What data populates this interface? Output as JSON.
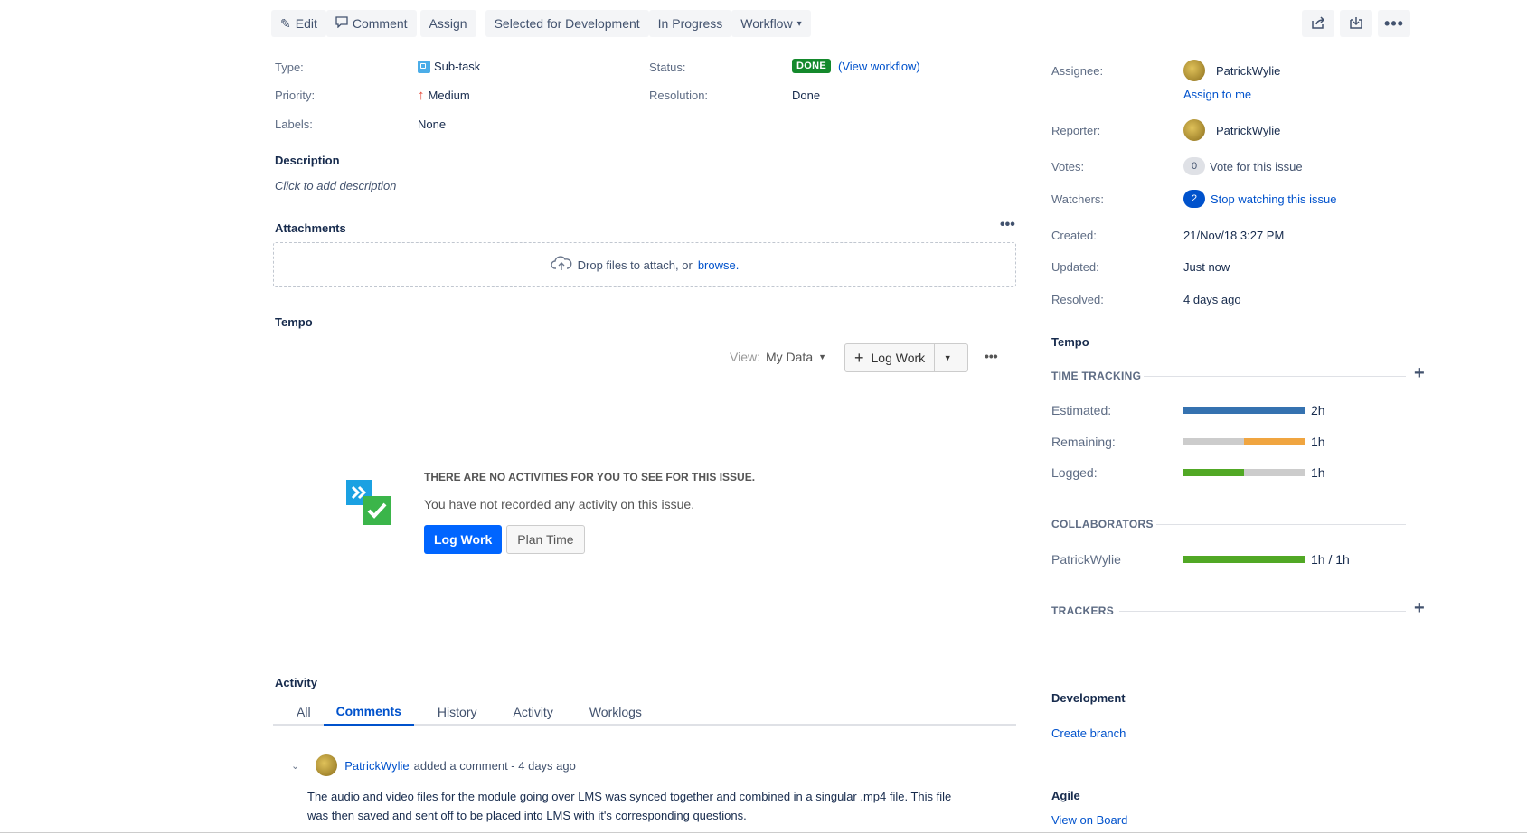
{
  "toolbar": {
    "edit": "Edit",
    "comment": "Comment",
    "assign": "Assign",
    "selected_for_dev": "Selected for Development",
    "in_progress": "In Progress",
    "workflow": "Workflow"
  },
  "details": {
    "type_label": "Type:",
    "type_value": "Sub-task",
    "priority_label": "Priority:",
    "priority_value": "Medium",
    "labels_label": "Labels:",
    "labels_value": "None",
    "status_label": "Status:",
    "status_value": "DONE",
    "view_workflow": "(View workflow)",
    "resolution_label": "Resolution:",
    "resolution_value": "Done"
  },
  "description": {
    "heading": "Description",
    "placeholder": "Click to add description"
  },
  "attachments": {
    "heading": "Attachments",
    "drop_text": "Drop files to attach, or",
    "browse": "browse."
  },
  "tempo": {
    "heading": "Tempo",
    "view_label": "View:",
    "view_value": "My Data",
    "log_work": "Log Work",
    "empty_title": "THERE ARE NO ACTIVITIES FOR YOU TO SEE FOR THIS ISSUE.",
    "empty_text": "You have not recorded any activity on this issue.",
    "log_work_btn": "Log Work",
    "plan_time_btn": "Plan Time"
  },
  "activity": {
    "heading": "Activity",
    "tabs": [
      "All",
      "Comments",
      "History",
      "Activity",
      "Worklogs"
    ],
    "comment_author": "PatrickWylie",
    "comment_meta": "added a comment - 4 days ago",
    "comment_line1": "The audio and video files for the module going over LMS was synced together and combined in a singular .mp4 file. This file",
    "comment_line2": "was then saved and sent off to be placed into LMS with it's corresponding questions."
  },
  "people": {
    "assignee_label": "Assignee:",
    "assignee": "PatrickWylie",
    "assign_to_me": "Assign to me",
    "reporter_label": "Reporter:",
    "reporter": "PatrickWylie",
    "votes_label": "Votes:",
    "votes_count": "0",
    "vote_text": "Vote for this issue",
    "watchers_label": "Watchers:",
    "watchers_count": "2",
    "watch_text": "Stop watching this issue"
  },
  "dates": {
    "created_label": "Created:",
    "created": "21/Nov/18 3:27 PM",
    "updated_label": "Updated:",
    "updated": "Just now",
    "resolved_label": "Resolved:",
    "resolved": "4 days ago"
  },
  "tempo_side": {
    "heading": "Tempo",
    "time_tracking": "TIME TRACKING",
    "estimated_label": "Estimated:",
    "estimated": "2h",
    "estimated_fill": 1.0,
    "remaining_label": "Remaining:",
    "remaining": "1h",
    "remaining_fill": 0.5,
    "logged_label": "Logged:",
    "logged": "1h",
    "logged_fill": 0.5,
    "collaborators": "COLLABORATORS",
    "collaborator_name": "PatrickWylie",
    "collaborator_value": "1h / 1h",
    "collaborator_fill": 1.0,
    "trackers": "TRACKERS",
    "colors": {
      "estimated": "#3572b0",
      "remaining": "#f0a540",
      "logged": "#51a825",
      "track": "#cccccc"
    }
  },
  "development": {
    "heading": "Development",
    "create_branch": "Create branch"
  },
  "agile": {
    "heading": "Agile",
    "view_on_board": "View on Board"
  }
}
